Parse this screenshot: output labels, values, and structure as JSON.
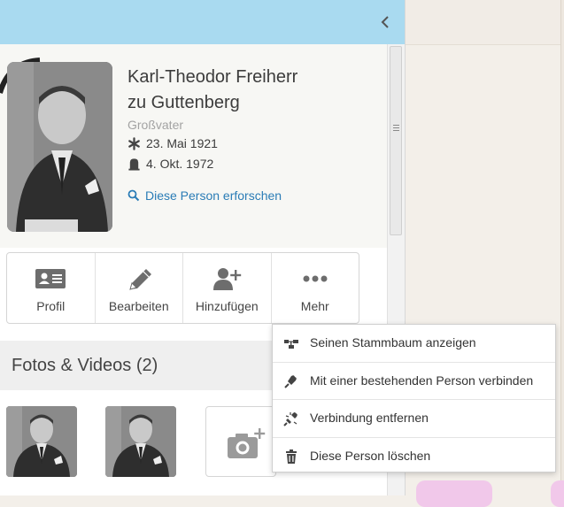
{
  "person": {
    "name_line1": "Karl-Theodor Freiherr",
    "name_line2": "zu Guttenberg",
    "relation": "Großvater",
    "birth": "23. Mai 1921",
    "death": "4. Okt. 1972",
    "research_link": "Diese Person erforschen"
  },
  "actions": [
    {
      "label": "Profil",
      "icon": "profile-card-icon"
    },
    {
      "label": "Bearbeiten",
      "icon": "pencil-icon"
    },
    {
      "label": "Hinzufügen",
      "icon": "add-person-icon"
    },
    {
      "label": "Mehr",
      "icon": "more-dots-icon"
    }
  ],
  "photos": {
    "title": "Fotos & Videos (2)",
    "add_icon": "camera-plus-icon"
  },
  "menu": {
    "items": [
      {
        "label": "Seinen Stammbaum anzeigen",
        "icon": "family-tree-icon"
      },
      {
        "label": "Mit einer bestehenden Person verbinden",
        "icon": "connect-plug-icon"
      },
      {
        "label": "Verbindung entfernen",
        "icon": "disconnect-plug-icon"
      },
      {
        "label": "Diese Person löschen",
        "icon": "trash-icon"
      }
    ]
  },
  "colors": {
    "header": "#a9daf0",
    "link": "#2a7cb6",
    "menu_highlight": "#f1c8ea"
  }
}
